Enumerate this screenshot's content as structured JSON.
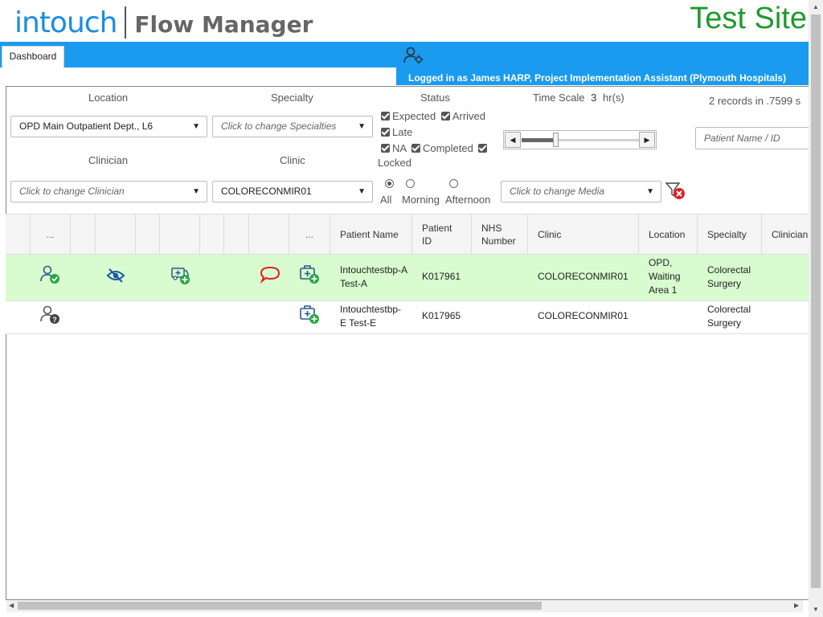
{
  "header": {
    "logo_brand": "intouch",
    "logo_product": "Flow Manager",
    "site_label": "Test Site"
  },
  "nav": {
    "tab_dashboard": "Dashboard",
    "logged_in_text": "Logged in as James HARP, Project Implementation Assistant (Plymouth Hospitals)"
  },
  "filters": {
    "location_label": "Location",
    "location_value": "OPD Main Outpatient Dept., L6",
    "specialty_label": "Specialty",
    "specialty_placeholder": "Click to change Specialties",
    "status_label": "Status",
    "status_options": [
      "Expected",
      "Arrived",
      "Late",
      "NA",
      "Completed",
      "Locked"
    ],
    "time_scale_label": "Time Scale",
    "time_scale_value": "3",
    "time_scale_unit": "hr(s)",
    "records_info": "2 records in .7599 s",
    "patient_search_placeholder": "Patient Name / ID",
    "clinician_label": "Clinician",
    "clinician_placeholder": "Click to change Clinician",
    "clinic_label": "Clinic",
    "clinic_value": "COLORECONMIR01",
    "session_options": [
      "All",
      "Morning",
      "Afternoon"
    ],
    "session_selected": "All",
    "media_placeholder": "Click to change Media"
  },
  "table": {
    "ellipsis": "...",
    "headers": {
      "patient_name": "Patient Name",
      "patient_id": "Patient ID",
      "nhs_number": "NHS Number",
      "clinic": "Clinic",
      "location": "Location",
      "specialty": "Specialty",
      "clinician": "Clinician"
    },
    "rows": [
      {
        "patient_name": "Intouchtestbp-A Test-A",
        "patient_id": "K017961",
        "nhs_number": "",
        "clinic": "COLORECONMIR01",
        "location": "OPD, Waiting Area 1",
        "specialty": "Colorectal Surgery",
        "clinician": ""
      },
      {
        "patient_name": "Intouchtestbp-E Test-E",
        "patient_id": "K017965",
        "nhs_number": "",
        "clinic": "COLORECONMIR01",
        "location": "",
        "specialty": "Colorectal Surgery",
        "clinician": ""
      }
    ]
  },
  "colors": {
    "brand_blue": "#1a9bf0",
    "test_site_green": "#1e9a2e",
    "row_highlight": "#d8fbd0",
    "status_green": "#27a845",
    "alert_red": "#e02020"
  }
}
